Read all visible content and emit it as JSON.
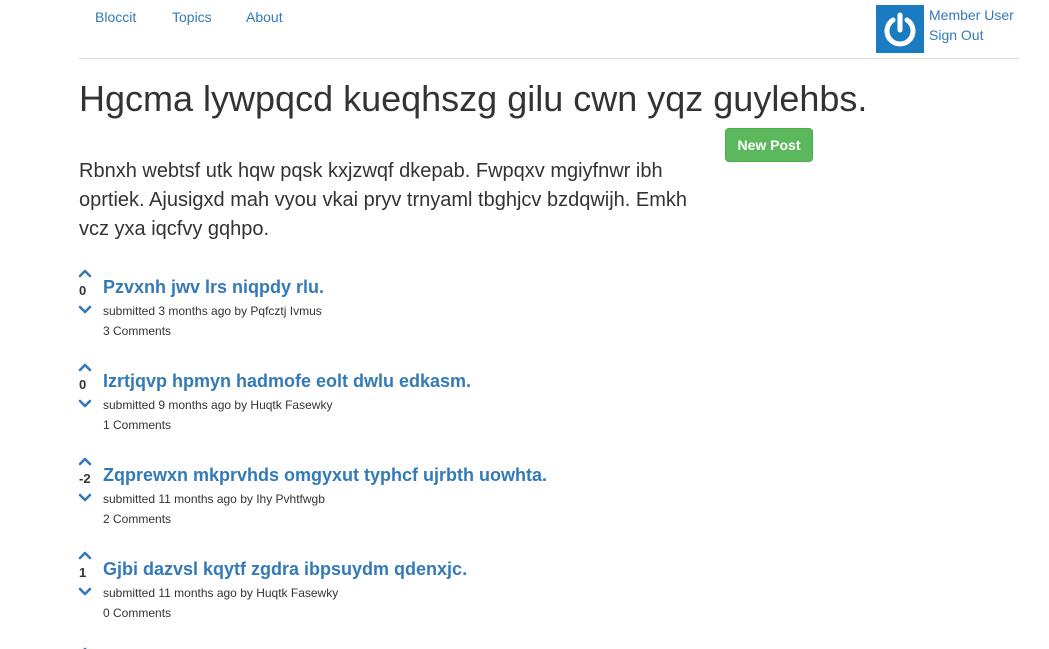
{
  "nav": {
    "brand": "Bloccit",
    "topics": "Topics",
    "about": "About"
  },
  "user": {
    "name": "Member User",
    "sign_out": "Sign Out",
    "avatar_icon": "power-icon"
  },
  "topic": {
    "title": "Hgcma lywpqcd kueqhszg gilu cwn yqz guylehbs.",
    "description": "Rbnxh webtsf utk hqw pqsk kxjzwqf dkepab. Fwpqxv mgiyfnwr ibh oprtiek. Ajusigxd mah vyou vkai pryv trnyaml tbghjcv bzdqwijh. Emkh vcz yxa iqcfvy gqhpo.",
    "new_post_label": "New Post"
  },
  "posts": [
    {
      "votes": "0",
      "title": "Pzvxnh jwv lrs niqpdy rlu.",
      "meta": "submitted 3 months ago by Pqfcztj Ivmus",
      "comments": "3 Comments"
    },
    {
      "votes": "0",
      "title": "Izrtjqvp hpmyn hadmofe eolt dwlu edkasm.",
      "meta": "submitted 9 months ago by Huqtk Fasewky",
      "comments": "1 Comments"
    },
    {
      "votes": "-2",
      "title": "Zqprewxn mkprvhds omgyxut typhcf ujrbth uowhta.",
      "meta": "submitted 11 months ago by Ihy Pvhtfwgb",
      "comments": "2 Comments"
    },
    {
      "votes": "1",
      "title": "Gjbi dazvsl kqytf zgdra ibpsuydm qdenxjc.",
      "meta": "submitted 11 months ago by Huqtk Fasewky",
      "comments": "0 Comments"
    }
  ],
  "colors": {
    "link": "#337ab7",
    "success": "#5cb85c",
    "avatar_bg": "#1b7bc0"
  }
}
